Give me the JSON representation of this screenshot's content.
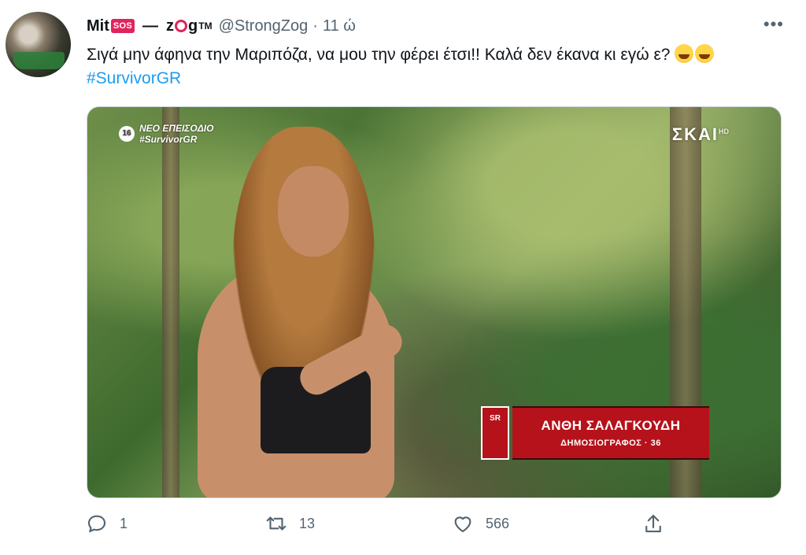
{
  "tweet": {
    "display_name_start": "Mit",
    "sos_badge": "SOS",
    "dash": "—",
    "display_name_z": "z",
    "display_name_g": "g",
    "tm": "TM",
    "handle": "@StrongZog",
    "separator": "·",
    "time": "11 ώ",
    "more_icon": "•••",
    "text": "Σιγά μην άφηνα την Μαριπόζα, να μου την φέρει έτσι!! Καλά δεν έκανα κι εγώ ε?",
    "hashtag": "#SurvivorGR",
    "emoji_name": "rolling-on-floor-laughing-emoji"
  },
  "media": {
    "age_rating": "16",
    "overlay_line1": "ΝΕΟ ΕΠΕΙΣΟΔΙΟ",
    "overlay_line2": "#SurvivorGR",
    "channel": "ΣΚΑΙ",
    "channel_hd": "HD",
    "lower_third_logo": "SR",
    "contestant_name": "ΑΝΘΗ ΣΑΛΑΓΚΟΥΔΗ",
    "contestant_role": "ΔΗΜΟΣΙΟΓΡΑΦΟΣ · 36"
  },
  "actions": {
    "reply_count": "1",
    "retweet_count": "13",
    "like_count": "566"
  },
  "colors": {
    "accent": "#1d9bf0",
    "text": "#0f1419",
    "muted": "#536471",
    "sos_red": "#e0245e",
    "lower_third_red": "#b5121b"
  }
}
